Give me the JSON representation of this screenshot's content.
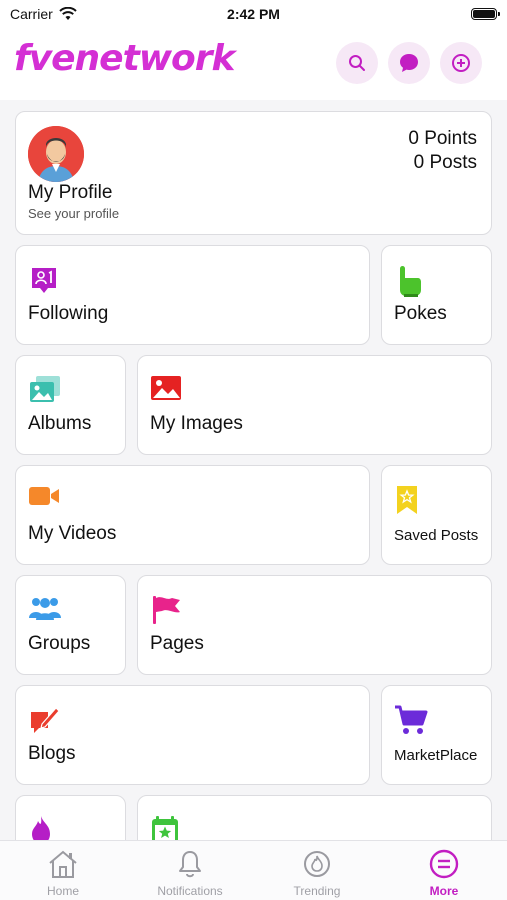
{
  "status_bar": {
    "carrier": "Carrier",
    "time": "2:42 PM"
  },
  "header": {
    "logo": "fvenetwork",
    "accent": "#d42fd4"
  },
  "profile": {
    "title": "My Profile",
    "subtitle": "See your profile",
    "points": "0 Points",
    "posts": "0 Posts"
  },
  "menu": {
    "following": "Following",
    "pokes": "Pokes",
    "albums": "Albums",
    "my_images": "My Images",
    "my_videos": "My Videos",
    "saved_posts": "Saved Posts",
    "groups": "Groups",
    "pages": "Pages",
    "blogs": "Blogs",
    "marketplace": "MarketPlace"
  },
  "tabbar": {
    "home": "Home",
    "notifications": "Notifications",
    "trending": "Trending",
    "more": "More"
  }
}
